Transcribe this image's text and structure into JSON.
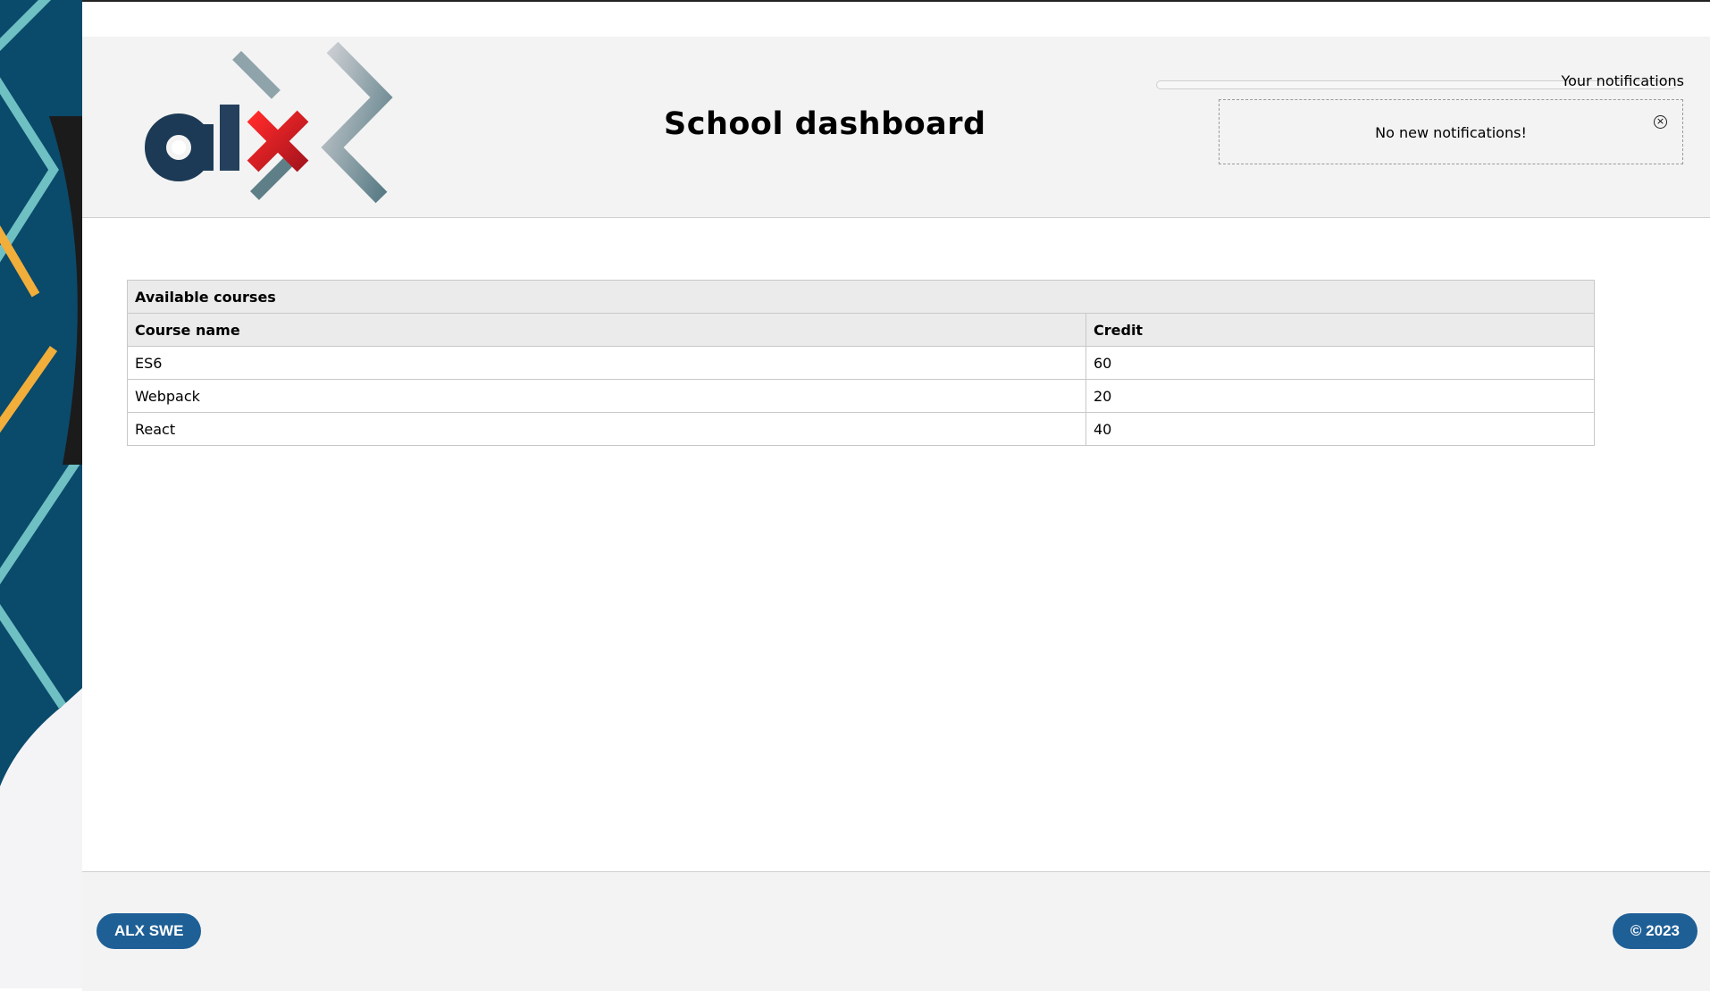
{
  "header": {
    "title": "School dashboard",
    "logo_text": "alx"
  },
  "notifications": {
    "title": "Your notifications",
    "message": "No new notifications!",
    "close_icon": "close-circle-icon"
  },
  "courses": {
    "caption": "Available courses",
    "columns": [
      "Course name",
      "Credit"
    ],
    "rows": [
      {
        "name": "ES6",
        "credit": "60"
      },
      {
        "name": "Webpack",
        "credit": "20"
      },
      {
        "name": "React",
        "credit": "40"
      }
    ]
  },
  "footer": {
    "left_label": "ALX SWE",
    "right_label": "© 2023"
  },
  "colors": {
    "header_bg": "#f3f3f3",
    "pill_bg": "#1e5f96",
    "logo_red": "#e1252f",
    "logo_dark": "#1c3a55",
    "side_bg": "#0a4a6b"
  }
}
